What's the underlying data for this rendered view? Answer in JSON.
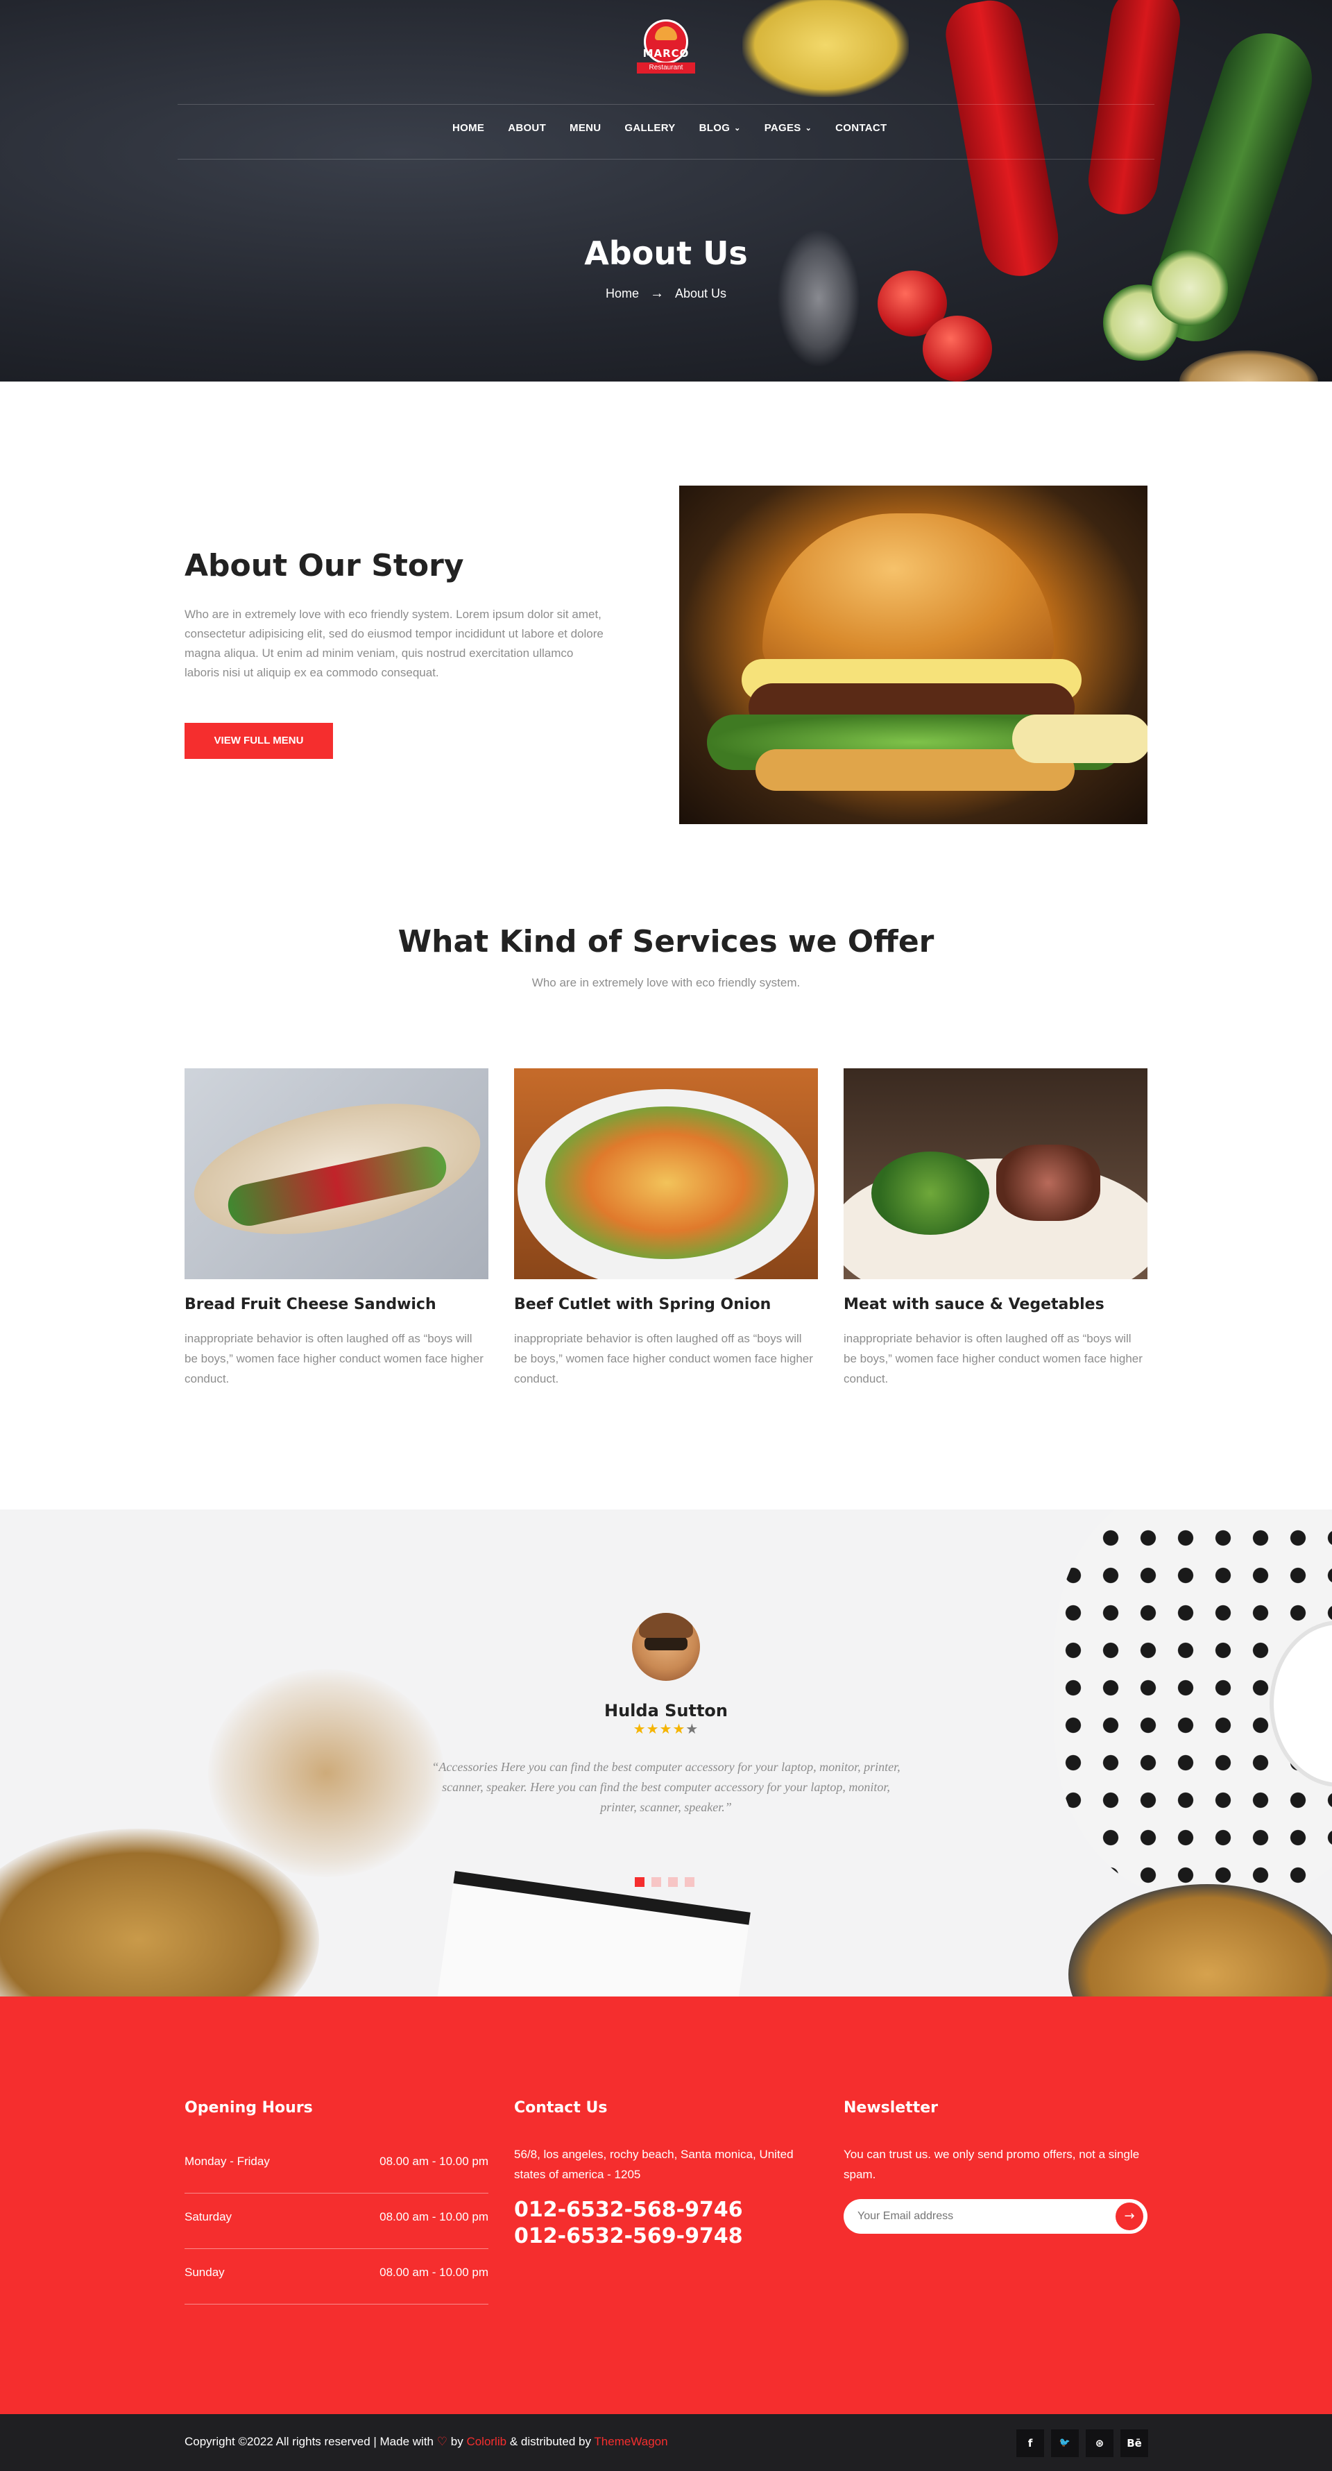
{
  "brand": {
    "name": "MARCO",
    "tagline": "Restaurant"
  },
  "nav": {
    "items": [
      {
        "label": "HOME",
        "dropdown": false
      },
      {
        "label": "ABOUT",
        "dropdown": false
      },
      {
        "label": "MENU",
        "dropdown": false
      },
      {
        "label": "GALLERY",
        "dropdown": false
      },
      {
        "label": "BLOG",
        "dropdown": true
      },
      {
        "label": "PAGES",
        "dropdown": true
      },
      {
        "label": "CONTACT",
        "dropdown": false
      }
    ],
    "chevron": "⌄"
  },
  "hero": {
    "title": "About Us",
    "breadcrumb": {
      "home": "Home",
      "arrow": "→",
      "current": "About Us"
    }
  },
  "story": {
    "title": "About Our Story",
    "text": "Who are in extremely love with eco friendly system. Lorem ipsum dolor sit amet, consectetur adipisicing elit, sed do eiusmod tempor incididunt ut labore et dolore magna aliqua. Ut enim ad minim veniam, quis nostrud exercitation ullamco laboris nisi ut aliquip ex ea commodo consequat.",
    "button": "VIEW FULL MENU"
  },
  "services": {
    "title": "What Kind of Services we Offer",
    "subtitle": "Who are in extremely love with eco friendly system.",
    "cards": [
      {
        "title": "Bread Fruit Cheese Sandwich",
        "text": "inappropriate behavior is often laughed off as “boys will be boys,” women face higher conduct women face higher conduct."
      },
      {
        "title": "Beef Cutlet with Spring Onion",
        "text": "inappropriate behavior is often laughed off as “boys will be boys,” women face higher conduct women face higher conduct."
      },
      {
        "title": "Meat with sauce & Vegetables",
        "text": "inappropriate behavior is often laughed off as “boys will be boys,” women face higher conduct women face higher conduct."
      }
    ]
  },
  "testimonial": {
    "name": "Hulda Sutton",
    "rating": 4,
    "max_rating": 5,
    "quote": "“Accessories Here you can find the best computer accessory for your laptop, monitor, printer, scanner, speaker. Here you can find the best computer accessory for your laptop, monitor, printer, scanner, speaker.”",
    "slides": 4,
    "active_slide": 0
  },
  "footer": {
    "hours_title": "Opening Hours",
    "hours": [
      {
        "day": "Monday - Friday",
        "time": "08.00 am - 10.00 pm"
      },
      {
        "day": "Saturday",
        "time": "08.00 am - 10.00 pm"
      },
      {
        "day": "Sunday",
        "time": "08.00 am - 10.00 pm"
      }
    ],
    "contact_title": "Contact Us",
    "address": "56/8, los angeles, rochy beach, Santa monica, United states of america - 1205",
    "phones": [
      "012-6532-568-9746",
      "012-6532-569-9748"
    ],
    "newsletter_title": "Newsletter",
    "newsletter_text": "You can trust us. we only send promo offers, not a single spam.",
    "email_placeholder": "Your Email address",
    "submit_icon": "→"
  },
  "bottom": {
    "copy_prefix": "Copyright ©2022 All rights reserved | Made with",
    "heart": "♡",
    "by": "by",
    "colorlib": "Colorlib",
    "distributed": "& distributed by",
    "themewagon": "ThemeWagon",
    "social": [
      {
        "name": "facebook-icon",
        "glyph": "f"
      },
      {
        "name": "twitter-icon",
        "glyph": "🐦"
      },
      {
        "name": "dribbble-icon",
        "glyph": "⊛"
      },
      {
        "name": "behance-icon",
        "glyph": "Bē"
      }
    ]
  },
  "colors": {
    "accent": "#f52e2e",
    "dark": "#1f1f22",
    "text_muted": "#8d8d8d"
  }
}
